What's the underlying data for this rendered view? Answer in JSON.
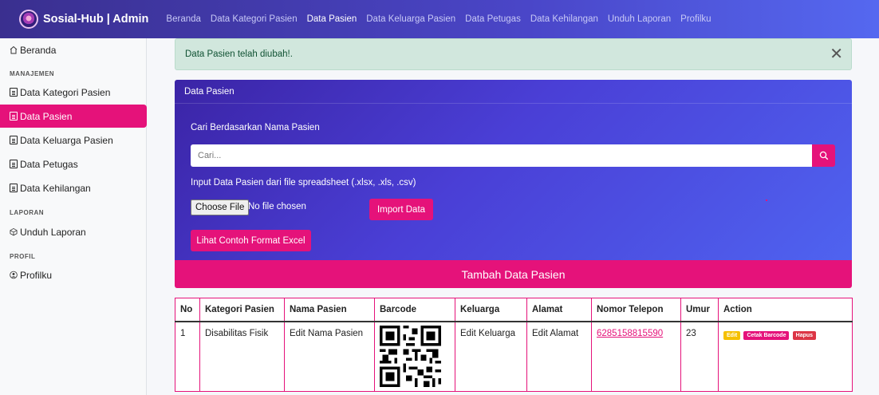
{
  "navbar": {
    "brand": "Sosial-Hub | Admin",
    "links": [
      "Beranda",
      "Data Kategori Pasien",
      "Data Pasien",
      "Data Keluarga Pasien",
      "Data Petugas",
      "Data Kehilangan",
      "Unduh Laporan",
      "Profilku"
    ],
    "active": "Data Pasien"
  },
  "sidebar": {
    "home": "Beranda",
    "section_manajemen": "MANAJEMEN",
    "items": [
      "Data Kategori Pasien",
      "Data Pasien",
      "Data Keluarga Pasien",
      "Data Petugas",
      "Data Kehilangan"
    ],
    "section_laporan": "LAPORAN",
    "unduh": "Unduh Laporan",
    "section_profil": "PROFIL",
    "profil": "Profilku"
  },
  "alert": {
    "message": "Data Pasien telah diubah!.",
    "close": "✕"
  },
  "card": {
    "title": "Data Pasien",
    "search_label": "Cari Berdasarkan Nama Pasien",
    "search_placeholder": "Cari...",
    "import_label": "Input Data Pasien dari file spreadsheet (.xlsx, .xls, .csv)",
    "choose_file": "Choose File",
    "no_file": "No file chosen",
    "import_button": "Import Data",
    "example_button": "Lihat Contoh Format Excel"
  },
  "add_button": "Tambah Data Pasien",
  "table": {
    "headers": [
      "No",
      "Kategori Pasien",
      "Nama Pasien",
      "Barcode",
      "Keluarga",
      "Alamat",
      "Nomor Telepon",
      "Umur",
      "Action"
    ],
    "rows": [
      {
        "no": "1",
        "kategori": "Disabilitas Fisik",
        "nama": "Edit Nama Pasien",
        "keluarga": "Edit Keluarga",
        "alamat": "Edit Alamat",
        "telepon": "6285158815590",
        "umur": "23",
        "actions": [
          "Edit",
          "Cetak Barcode",
          "Hapus"
        ]
      }
    ]
  },
  "colors": {
    "accent": "#e5127a",
    "navbar": "#4a46c8",
    "alert_bg": "#d1e7dd"
  }
}
